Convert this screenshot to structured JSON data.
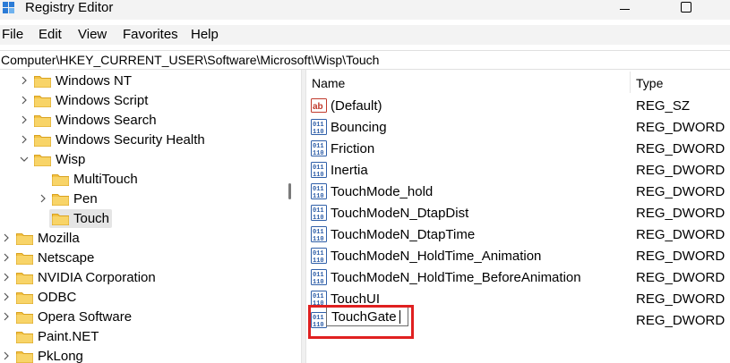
{
  "window": {
    "title": "Registry Editor"
  },
  "menu": [
    "File",
    "Edit",
    "View",
    "Favorites",
    "Help"
  ],
  "address": "Computer\\HKEY_CURRENT_USER\\Software\\Microsoft\\Wisp\\Touch",
  "tree": [
    {
      "label": "Windows NT",
      "expander": "collapsed"
    },
    {
      "label": "Windows Script",
      "expander": "collapsed"
    },
    {
      "label": "Windows Search",
      "expander": "collapsed"
    },
    {
      "label": "Windows Security Health",
      "expander": "collapsed"
    },
    {
      "label": "Wisp",
      "expander": "expanded"
    },
    {
      "label": "MultiTouch",
      "expander": "none"
    },
    {
      "label": "Pen",
      "expander": "collapsed"
    },
    {
      "label": "Touch",
      "expander": "none",
      "selected": true
    },
    {
      "label": "Mozilla",
      "expander": "collapsed"
    },
    {
      "label": "Netscape",
      "expander": "collapsed"
    },
    {
      "label": "NVIDIA Corporation",
      "expander": "collapsed"
    },
    {
      "label": "ODBC",
      "expander": "collapsed"
    },
    {
      "label": "Opera Software",
      "expander": "collapsed"
    },
    {
      "label": "Paint.NET",
      "expander": "none"
    },
    {
      "label": "PkLong",
      "expander": "collapsed"
    }
  ],
  "columns": {
    "name": "Name",
    "type": "Type"
  },
  "values": [
    {
      "name": "(Default)",
      "type": "REG_SZ",
      "icon": "string-value-icon"
    },
    {
      "name": "Bouncing",
      "type": "REG_DWORD",
      "icon": "binary-value-icon"
    },
    {
      "name": "Friction",
      "type": "REG_DWORD",
      "icon": "binary-value-icon"
    },
    {
      "name": "Inertia",
      "type": "REG_DWORD",
      "icon": "binary-value-icon"
    },
    {
      "name": "TouchMode_hold",
      "type": "REG_DWORD",
      "icon": "binary-value-icon"
    },
    {
      "name": "TouchModeN_DtapDist",
      "type": "REG_DWORD",
      "icon": "binary-value-icon"
    },
    {
      "name": "TouchModeN_DtapTime",
      "type": "REG_DWORD",
      "icon": "binary-value-icon"
    },
    {
      "name": "TouchModeN_HoldTime_Animation",
      "type": "REG_DWORD",
      "icon": "binary-value-icon"
    },
    {
      "name": "TouchModeN_HoldTime_BeforeAnimation",
      "type": "REG_DWORD",
      "icon": "binary-value-icon"
    },
    {
      "name": "TouchUI",
      "type": "REG_DWORD",
      "icon": "binary-value-icon"
    },
    {
      "name": "TouchGate",
      "type": "REG_DWORD",
      "icon": "binary-value-icon",
      "editing": true
    }
  ],
  "colors": {
    "highlight": "#e02020",
    "folder": "#f3c245",
    "selection": "#e5e5e5"
  }
}
